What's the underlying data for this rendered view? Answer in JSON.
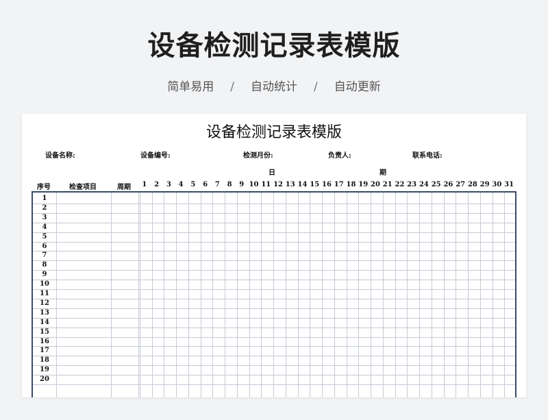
{
  "hero": {
    "title": "设备检测记录表模版",
    "features": [
      "简单易用",
      "自动统计",
      "自动更新"
    ],
    "separator": "/"
  },
  "sheet": {
    "title": "设备检测记录表模版",
    "info_labels": [
      "设备名称:",
      "设备编号:",
      "检测月份:",
      "负责人:",
      "联系电话:"
    ],
    "day_header": [
      "日",
      "期"
    ],
    "col_headers": {
      "seq": "序号",
      "item": "检查项目",
      "cycle": "周期"
    },
    "days": [
      "1",
      "2",
      "3",
      "4",
      "5",
      "6",
      "7",
      "8",
      "9",
      "10",
      "11",
      "12",
      "13",
      "14",
      "15",
      "16",
      "17",
      "18",
      "19",
      "20",
      "21",
      "22",
      "23",
      "24",
      "25",
      "26",
      "27",
      "28",
      "29",
      "30",
      "31"
    ],
    "rows": [
      "1",
      "2",
      "3",
      "4",
      "5",
      "6",
      "7",
      "8",
      "9",
      "10",
      "11",
      "12",
      "13",
      "14",
      "15",
      "16",
      "17",
      "18",
      "19",
      "20"
    ]
  },
  "colors": {
    "grid_border": "#3a4a66",
    "grid_line": "#c5cad6",
    "background": "#f2f3f5"
  }
}
